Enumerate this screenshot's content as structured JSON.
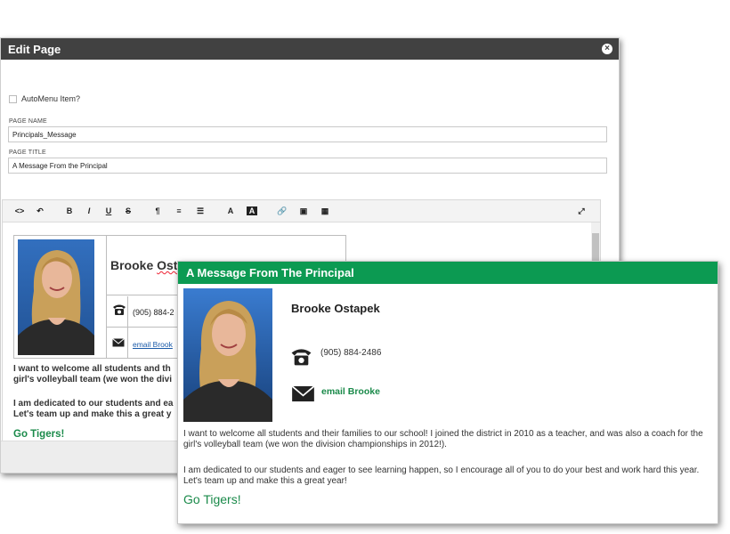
{
  "dialog": {
    "title": "Edit Page",
    "close_label": "×",
    "automenu_label": "AutoMenu Item?",
    "page_name_label": "PAGE NAME",
    "page_name_value": "Principals_Message",
    "page_title_label": "PAGE TITLE",
    "page_title_value": "A Message From the Principal"
  },
  "toolbar": {
    "code": "<>",
    "undo": "↶",
    "bold": "B",
    "italic": "I",
    "underline": "U",
    "strike": "S",
    "paragraph": "¶",
    "align": "≡",
    "list": "☰",
    "font_color": "A",
    "bg_color": "A",
    "link": "🔗",
    "image": "▣",
    "table": "▦",
    "fullscreen": "⤢"
  },
  "editor": {
    "name": "Brooke Ostapek",
    "name_first": "Brooke",
    "name_last": "Ostapek",
    "phone": "(905) 884-2",
    "email": "email Brook",
    "para1_line1": "I want to welcome all students and th",
    "para1_line2": "girl's volleyball team (we won the divi",
    "para2_line1": "I am dedicated to our students and ea",
    "para2_line2": "Let's team up and make this a great y",
    "closing": "Go Tigers!"
  },
  "preview": {
    "header": "A Message From The Principal",
    "name": "Brooke Ostapek",
    "phone": "(905) 884-2486",
    "email": "email Brooke",
    "para1": "I want to welcome all students and their families to our school! I joined the district in 2010 as a teacher, and was also a coach for the girl's volleyball team (we won the division championships in 2012!).",
    "para2": "I am dedicated to our students and eager to see learning happen, so I encourage all of you to do your best and work hard this year. Let's team up and make this a great year!",
    "closing": "Go Tigers!"
  },
  "colors": {
    "header_dark": "#414141",
    "accent_green": "#0c9a52",
    "link_blue": "#1a5aa8"
  }
}
